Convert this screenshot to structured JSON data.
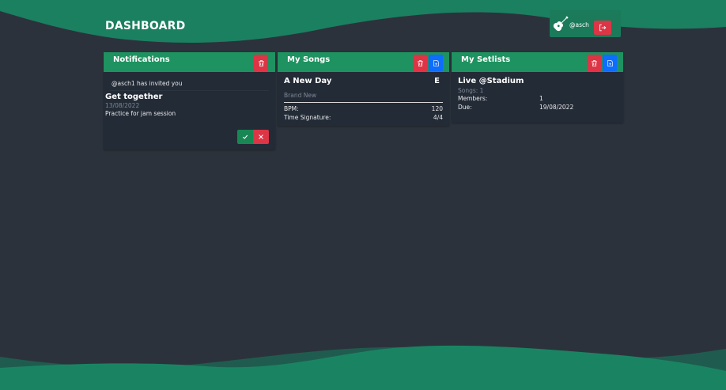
{
  "header": {
    "title": "DASHBOARD",
    "username": "@asch"
  },
  "notifications": {
    "title": "Notifications",
    "invite_text": "@asch1 has invited you",
    "item_title": "Get together",
    "item_date": "13/08/2022",
    "item_desc": "Practice for jam session"
  },
  "songs": {
    "title": "My Songs",
    "song_title": "A New Day",
    "song_key": "E",
    "song_subtitle": "Brand New",
    "bpm_label": "BPM:",
    "bpm_value": "120",
    "time_sig_label": "Time Signature:",
    "time_sig_value": "4/4"
  },
  "setlists": {
    "title": "My Setlists",
    "setlist_title": "Live @Stadium",
    "songs_count": "Songs: 1",
    "members_label": "Members:",
    "members_value": "1",
    "due_label": "Due:",
    "due_value": "19/08/2022"
  },
  "colors": {
    "background": "#2c323b",
    "card": "#232b37",
    "accent_green": "#1e9260",
    "danger": "#dc3545",
    "primary": "#0d6efd",
    "success": "#198754"
  },
  "icons": [
    "guitar-icon",
    "logout-icon",
    "trash-icon",
    "add-file-icon",
    "check-icon",
    "x-icon"
  ]
}
